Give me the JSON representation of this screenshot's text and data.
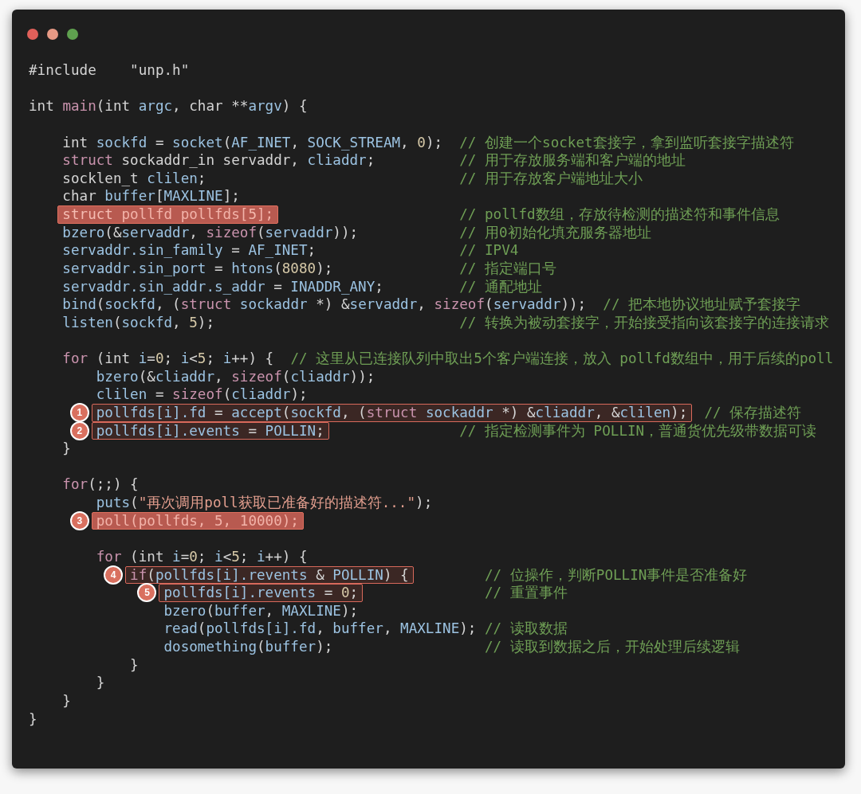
{
  "window": {
    "controls": [
      {
        "kind": "close"
      },
      {
        "kind": "minimize"
      },
      {
        "kind": "zoom"
      }
    ]
  },
  "code_lines": [
    {
      "kind": "code",
      "segments": [
        {
          "kind": "plain",
          "text": "#include    \"unp.h\""
        }
      ]
    },
    {
      "kind": "blank"
    },
    {
      "kind": "code",
      "segments": [
        {
          "kind": "plain",
          "text": "int "
        },
        {
          "kind": "keyword",
          "text": "main"
        },
        {
          "kind": "plain",
          "text": "(int "
        },
        {
          "kind": "name",
          "text": "argc"
        },
        {
          "kind": "plain",
          "text": ", char **"
        },
        {
          "kind": "name",
          "text": "argv"
        },
        {
          "kind": "plain",
          "text": ") {"
        }
      ],
      "children": [
        {
          "kind": "blank"
        },
        {
          "kind": "code",
          "segments": [
            {
              "kind": "plain",
              "text": "int "
            },
            {
              "kind": "name",
              "text": "sockfd"
            },
            {
              "kind": "plain",
              "text": " = "
            },
            {
              "kind": "name",
              "text": "socket"
            },
            {
              "kind": "plain",
              "text": "("
            },
            {
              "kind": "name",
              "text": "AF_INET"
            },
            {
              "kind": "plain",
              "text": ", "
            },
            {
              "kind": "name",
              "text": "SOCK_STREAM"
            },
            {
              "kind": "plain",
              "text": ", "
            },
            {
              "kind": "number",
              "text": "0"
            },
            {
              "kind": "plain",
              "text": ");  "
            },
            {
              "kind": "comment",
              "text": "// 创建一个socket套接字，拿到监听套接字描述符"
            }
          ]
        },
        {
          "kind": "code",
          "segments": [
            {
              "kind": "keyword",
              "text": "struct"
            },
            {
              "kind": "plain",
              "text": " sockaddr_in servaddr, "
            },
            {
              "kind": "name",
              "text": "cliaddr"
            },
            {
              "kind": "plain",
              "text": ";          "
            },
            {
              "kind": "comment",
              "text": "// 用于存放服务端和客户端的地址"
            }
          ]
        },
        {
          "kind": "code",
          "segments": [
            {
              "kind": "plain",
              "text": "socklen_t "
            },
            {
              "kind": "name",
              "text": "clilen"
            },
            {
              "kind": "plain",
              "text": ";                              "
            },
            {
              "kind": "comment",
              "text": "// 用于存放客户端地址大小"
            }
          ]
        },
        {
          "kind": "code",
          "segments": [
            {
              "kind": "plain",
              "text": "char "
            },
            {
              "kind": "name",
              "text": "buffer"
            },
            {
              "kind": "plain",
              "text": "["
            },
            {
              "kind": "name",
              "text": "MAXLINE"
            },
            {
              "kind": "plain",
              "text": "];"
            }
          ]
        },
        {
          "kind": "code",
          "segments": [
            {
              "kind": "filled_highlight",
              "segments": [
                {
                  "kind": "keyword",
                  "text": "struct"
                },
                {
                  "kind": "plain",
                  "text": " pollfd pollfds["
                },
                {
                  "kind": "number",
                  "text": "5"
                },
                {
                  "kind": "plain",
                  "text": "];"
                }
              ]
            },
            {
              "kind": "comment",
              "text": "                      // pollfd数组，存放待检测的描述符和事件信息"
            }
          ]
        },
        {
          "kind": "code",
          "segments": [
            {
              "kind": "name",
              "text": "bzero"
            },
            {
              "kind": "plain",
              "text": "(&"
            },
            {
              "kind": "name",
              "text": "servaddr"
            },
            {
              "kind": "plain",
              "text": ", "
            },
            {
              "kind": "keyword",
              "text": "sizeof"
            },
            {
              "kind": "plain",
              "text": "("
            },
            {
              "kind": "name",
              "text": "servaddr"
            },
            {
              "kind": "plain",
              "text": "));            "
            },
            {
              "kind": "comment",
              "text": "// 用0初始化填充服务器地址"
            }
          ]
        },
        {
          "kind": "code",
          "segments": [
            {
              "kind": "name",
              "text": "servaddr.sin_family"
            },
            {
              "kind": "plain",
              "text": " = "
            },
            {
              "kind": "name",
              "text": "AF_INET"
            },
            {
              "kind": "plain",
              "text": ";                 "
            },
            {
              "kind": "comment",
              "text": "// IPV4"
            }
          ]
        },
        {
          "kind": "code",
          "segments": [
            {
              "kind": "name",
              "text": "servaddr.sin_port"
            },
            {
              "kind": "plain",
              "text": " = "
            },
            {
              "kind": "name",
              "text": "htons"
            },
            {
              "kind": "plain",
              "text": "("
            },
            {
              "kind": "number",
              "text": "8080"
            },
            {
              "kind": "plain",
              "text": ");               "
            },
            {
              "kind": "comment",
              "text": "// 指定端口号"
            }
          ]
        },
        {
          "kind": "code",
          "segments": [
            {
              "kind": "name",
              "text": "servaddr.sin_addr.s_addr"
            },
            {
              "kind": "plain",
              "text": " = "
            },
            {
              "kind": "name",
              "text": "INADDR_ANY"
            },
            {
              "kind": "plain",
              "text": ";         "
            },
            {
              "kind": "comment",
              "text": "// 通配地址"
            }
          ]
        },
        {
          "kind": "code",
          "segments": [
            {
              "kind": "name",
              "text": "bind"
            },
            {
              "kind": "plain",
              "text": "("
            },
            {
              "kind": "name",
              "text": "sockfd"
            },
            {
              "kind": "plain",
              "text": ", ("
            },
            {
              "kind": "keyword",
              "text": "struct "
            },
            {
              "kind": "name",
              "text": "sockaddr"
            },
            {
              "kind": "plain",
              "text": " *) &"
            },
            {
              "kind": "name",
              "text": "servaddr"
            },
            {
              "kind": "plain",
              "text": ", "
            },
            {
              "kind": "keyword",
              "text": "sizeof"
            },
            {
              "kind": "plain",
              "text": "("
            },
            {
              "kind": "name",
              "text": "servaddr"
            },
            {
              "kind": "plain",
              "text": "));  "
            },
            {
              "kind": "comment",
              "text": "// 把本地协议地址赋予套接字"
            }
          ]
        },
        {
          "kind": "code",
          "segments": [
            {
              "kind": "name",
              "text": "listen"
            },
            {
              "kind": "plain",
              "text": "("
            },
            {
              "kind": "name",
              "text": "sockfd"
            },
            {
              "kind": "plain",
              "text": ", "
            },
            {
              "kind": "number",
              "text": "5"
            },
            {
              "kind": "plain",
              "text": ");                             "
            },
            {
              "kind": "comment",
              "text": "// 转换为被动套接字，开始接受指向该套接字的连接请求"
            }
          ]
        },
        {
          "kind": "blank"
        },
        {
          "kind": "code",
          "segments": [
            {
              "kind": "keyword",
              "text": "for"
            },
            {
              "kind": "plain",
              "text": " (int "
            },
            {
              "kind": "name",
              "text": "i"
            },
            {
              "kind": "plain",
              "text": "="
            },
            {
              "kind": "number",
              "text": "0"
            },
            {
              "kind": "plain",
              "text": "; "
            },
            {
              "kind": "name",
              "text": "i"
            },
            {
              "kind": "plain",
              "text": "<"
            },
            {
              "kind": "number",
              "text": "5"
            },
            {
              "kind": "plain",
              "text": "; "
            },
            {
              "kind": "name",
              "text": "i"
            },
            {
              "kind": "plain",
              "text": "++) {  "
            },
            {
              "kind": "comment",
              "text": "// 这里从已连接队列中取出5个客户端连接，放入 pollfd数组中，用于后续的poll"
            }
          ],
          "children": [
            {
              "kind": "code",
              "segments": [
                {
                  "kind": "name",
                  "text": "bzero"
                },
                {
                  "kind": "plain",
                  "text": "(&"
                },
                {
                  "kind": "name",
                  "text": "cliaddr"
                },
                {
                  "kind": "plain",
                  "text": ", "
                },
                {
                  "kind": "keyword",
                  "text": "sizeof"
                },
                {
                  "kind": "plain",
                  "text": "("
                },
                {
                  "kind": "name",
                  "text": "cliaddr"
                },
                {
                  "kind": "plain",
                  "text": "));"
                }
              ]
            },
            {
              "kind": "code",
              "segments": [
                {
                  "kind": "name",
                  "text": "clilen"
                },
                {
                  "kind": "plain",
                  "text": " = "
                },
                {
                  "kind": "keyword",
                  "text": "sizeof"
                },
                {
                  "kind": "plain",
                  "text": "("
                },
                {
                  "kind": "name",
                  "text": "cliaddr"
                },
                {
                  "kind": "plain",
                  "text": ");"
                }
              ]
            },
            {
              "kind": "code",
              "segments": [
                {
                  "kind": "outlined_highlight",
                  "badge": "1",
                  "segments": [
                    {
                      "kind": "name",
                      "text": "pollfds[i].fd"
                    },
                    {
                      "kind": "plain",
                      "text": " = "
                    },
                    {
                      "kind": "name",
                      "text": "accept"
                    },
                    {
                      "kind": "plain",
                      "text": "("
                    },
                    {
                      "kind": "name",
                      "text": "sockfd"
                    },
                    {
                      "kind": "plain",
                      "text": ", ("
                    },
                    {
                      "kind": "keyword",
                      "text": "struct "
                    },
                    {
                      "kind": "name",
                      "text": "sockaddr"
                    },
                    {
                      "kind": "plain",
                      "text": " *) &"
                    },
                    {
                      "kind": "name",
                      "text": "cliaddr"
                    },
                    {
                      "kind": "plain",
                      "text": ", &"
                    },
                    {
                      "kind": "name",
                      "text": "clilen"
                    },
                    {
                      "kind": "plain",
                      "text": ");"
                    }
                  ]
                },
                {
                  "kind": "comment",
                  "text": "  // 保存描述符"
                }
              ]
            },
            {
              "kind": "code",
              "segments": [
                {
                  "kind": "outlined_highlight",
                  "badge": "2",
                  "segments": [
                    {
                      "kind": "name",
                      "text": "pollfds[i].events"
                    },
                    {
                      "kind": "plain",
                      "text": " = "
                    },
                    {
                      "kind": "name",
                      "text": "POLLIN"
                    },
                    {
                      "kind": "plain",
                      "text": ";"
                    }
                  ]
                },
                {
                  "kind": "comment",
                  "text": "                // 指定检测事件为 POLLIN，普通货优先级带数据可读"
                }
              ]
            }
          ]
        },
        {
          "kind": "code",
          "segments": [
            {
              "kind": "plain",
              "text": "}"
            }
          ]
        },
        {
          "kind": "blank"
        },
        {
          "kind": "code",
          "segments": [
            {
              "kind": "keyword",
              "text": "for"
            },
            {
              "kind": "plain",
              "text": "(;;) {"
            }
          ],
          "children": [
            {
              "kind": "code",
              "segments": [
                {
                  "kind": "name",
                  "text": "puts"
                },
                {
                  "kind": "plain",
                  "text": "("
                },
                {
                  "kind": "string",
                  "text": "\"再次调用poll获取已准备好的描述符...\""
                },
                {
                  "kind": "plain",
                  "text": ");"
                }
              ]
            },
            {
              "kind": "code",
              "segments": [
                {
                  "kind": "filled_highlight",
                  "badge": "3",
                  "segments": [
                    {
                      "kind": "plain",
                      "text": "poll(pollfds, 5, 10000);"
                    }
                  ]
                }
              ]
            },
            {
              "kind": "blank"
            },
            {
              "kind": "code",
              "segments": [
                {
                  "kind": "keyword",
                  "text": "for"
                },
                {
                  "kind": "plain",
                  "text": " (int "
                },
                {
                  "kind": "name",
                  "text": "i"
                },
                {
                  "kind": "plain",
                  "text": "="
                },
                {
                  "kind": "number",
                  "text": "0"
                },
                {
                  "kind": "plain",
                  "text": "; "
                },
                {
                  "kind": "name",
                  "text": "i"
                },
                {
                  "kind": "plain",
                  "text": "<"
                },
                {
                  "kind": "number",
                  "text": "5"
                },
                {
                  "kind": "plain",
                  "text": "; "
                },
                {
                  "kind": "name",
                  "text": "i"
                },
                {
                  "kind": "plain",
                  "text": "++) {"
                }
              ],
              "children": [
                {
                  "kind": "code",
                  "segments": [
                    {
                      "kind": "outlined_highlight",
                      "badge": "4",
                      "segments": [
                        {
                          "kind": "keyword",
                          "text": "if"
                        },
                        {
                          "kind": "plain",
                          "text": "("
                        },
                        {
                          "kind": "name",
                          "text": "pollfds[i].revents"
                        },
                        {
                          "kind": "plain",
                          "text": " & "
                        },
                        {
                          "kind": "name",
                          "text": "POLLIN"
                        },
                        {
                          "kind": "plain",
                          "text": ") {"
                        }
                      ]
                    },
                    {
                      "kind": "comment",
                      "text": "         // 位操作，判断POLLIN事件是否准备好"
                    }
                  ],
                  "children": [
                    {
                      "kind": "code",
                      "segments": [
                        {
                          "kind": "outlined_highlight",
                          "badge": "5",
                          "segments": [
                            {
                              "kind": "name",
                              "text": "pollfds[i].revents"
                            },
                            {
                              "kind": "plain",
                              "text": " = "
                            },
                            {
                              "kind": "number",
                              "text": "0"
                            },
                            {
                              "kind": "plain",
                              "text": ";"
                            }
                          ]
                        },
                        {
                          "kind": "comment",
                          "text": "               // 重置事件"
                        }
                      ]
                    },
                    {
                      "kind": "code",
                      "segments": [
                        {
                          "kind": "name",
                          "text": "bzero"
                        },
                        {
                          "kind": "plain",
                          "text": "("
                        },
                        {
                          "kind": "name",
                          "text": "buffer"
                        },
                        {
                          "kind": "plain",
                          "text": ", "
                        },
                        {
                          "kind": "name",
                          "text": "MAXLINE"
                        },
                        {
                          "kind": "plain",
                          "text": ");"
                        }
                      ]
                    },
                    {
                      "kind": "code",
                      "segments": [
                        {
                          "kind": "name",
                          "text": "read"
                        },
                        {
                          "kind": "plain",
                          "text": "("
                        },
                        {
                          "kind": "name",
                          "text": "pollfds[i].fd"
                        },
                        {
                          "kind": "plain",
                          "text": ", "
                        },
                        {
                          "kind": "name",
                          "text": "buffer"
                        },
                        {
                          "kind": "plain",
                          "text": ", "
                        },
                        {
                          "kind": "name",
                          "text": "MAXLINE"
                        },
                        {
                          "kind": "plain",
                          "text": "); "
                        },
                        {
                          "kind": "comment",
                          "text": "// 读取数据"
                        }
                      ]
                    },
                    {
                      "kind": "code",
                      "segments": [
                        {
                          "kind": "name",
                          "text": "dosomething"
                        },
                        {
                          "kind": "plain",
                          "text": "("
                        },
                        {
                          "kind": "name",
                          "text": "buffer"
                        },
                        {
                          "kind": "plain",
                          "text": ");                  "
                        },
                        {
                          "kind": "comment",
                          "text": "// 读取到数据之后，开始处理后续逻辑"
                        }
                      ]
                    }
                  ]
                },
                {
                  "kind": "code",
                  "segments": [
                    {
                      "kind": "plain",
                      "text": "}"
                    }
                  ]
                }
              ]
            },
            {
              "kind": "code",
              "segments": [
                {
                  "kind": "plain",
                  "text": "}"
                }
              ]
            }
          ]
        },
        {
          "kind": "code",
          "segments": [
            {
              "kind": "plain",
              "text": "}"
            }
          ]
        }
      ]
    },
    {
      "kind": "code",
      "segments": [
        {
          "kind": "plain",
          "text": "}"
        }
      ]
    }
  ]
}
